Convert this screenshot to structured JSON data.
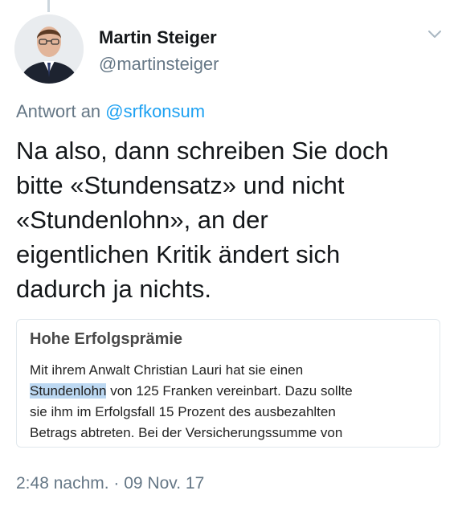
{
  "author": {
    "name": "Martin Steiger",
    "handle": "@martinsteiger"
  },
  "reply": {
    "prefix": "Antwort an",
    "mention": "@srfkonsum"
  },
  "tweet": {
    "lines": [
      "Na also, dann schreiben Sie doch",
      "bitte «Stundensatz» und nicht",
      "«Stundenlohn», an der",
      "eigentlichen Kritik ändert sich",
      "dadurch ja nichts."
    ]
  },
  "quote": {
    "title": "Hohe Erfolgsprämie",
    "line1": "Mit ihrem Anwalt Christian Lauri hat sie einen",
    "line2_highlight": "Stundenlohn",
    "line2_rest": " von 125 Franken vereinbart. Dazu sollte",
    "line3": "sie ihm im Erfolgsfall 15 Prozent des ausbezahlten",
    "line4": "Betrags abtreten. Bei der Versicherungssumme von"
  },
  "meta": {
    "time": "2:48 nachm.",
    "separator": " · ",
    "date": "09 Nov. 17"
  },
  "icons": {
    "more": "chevron-down-icon",
    "avatar": "avatar-photo"
  },
  "colors": {
    "mention": "#1da1f2",
    "secondary_text": "#657786",
    "highlight": "#bcd8f2"
  }
}
